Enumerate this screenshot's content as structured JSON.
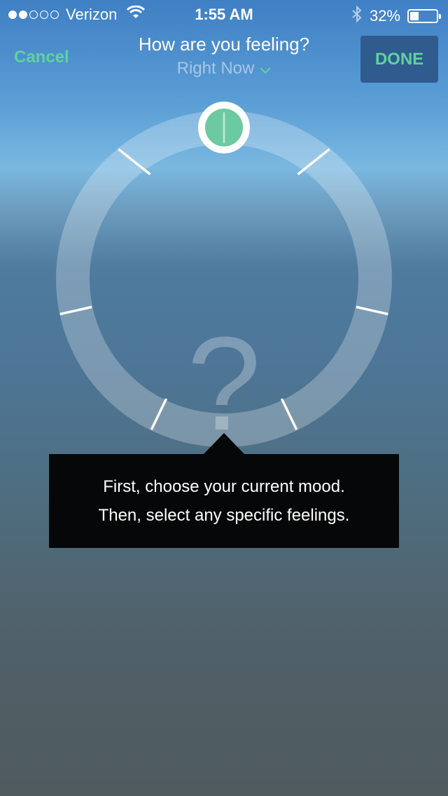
{
  "status_bar": {
    "carrier": "Verizon",
    "time": "1:55 AM",
    "battery_percent_label": "32%",
    "battery_level": 0.32,
    "signal_bars_filled": 2,
    "signal_bars_total": 5,
    "icons": [
      "wifi-icon",
      "bluetooth-icon",
      "battery-icon"
    ]
  },
  "nav": {
    "cancel_label": "Cancel",
    "title": "How are you feeling?",
    "subtitle": "Right Now",
    "done_label": "DONE"
  },
  "mood_wheel": {
    "center_symbol": "?",
    "handle_color": "#6cc9a1",
    "segment_count": 7
  },
  "tooltip": {
    "line1": "First, choose your current mood.",
    "line2": "Then, select any specific feelings."
  },
  "colors": {
    "accent": "#5fd3a0",
    "done_background": "#2f5b8e",
    "tooltip_background": "#060708"
  }
}
